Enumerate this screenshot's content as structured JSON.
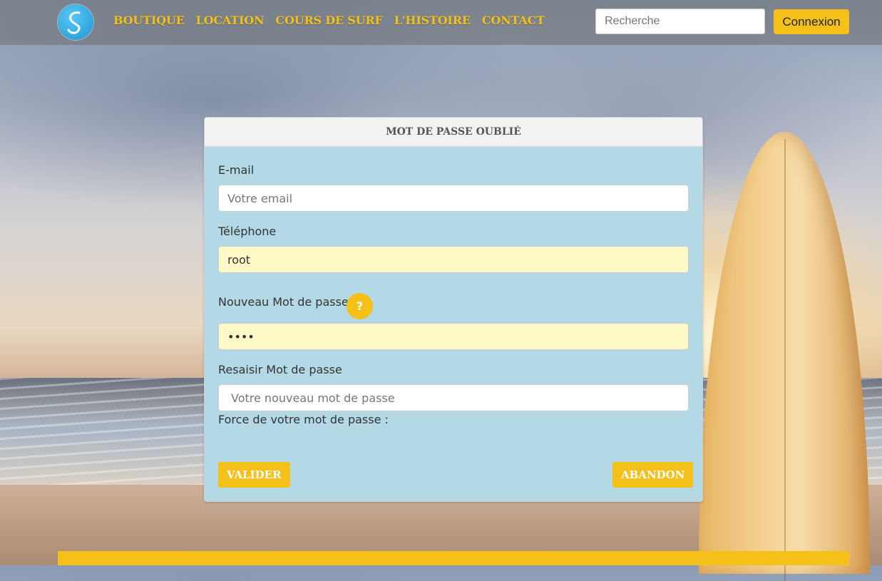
{
  "nav": {
    "links": [
      "BOUTIQUE",
      "LOCATION",
      "COURS DE SURF",
      "L'HISTOIRE",
      "CONTACT"
    ],
    "search_placeholder": "Recherche",
    "login_label": "Connexion"
  },
  "form": {
    "title": "MOT DE PASSE OUBLIÉ",
    "email_label": "E-mail",
    "email_placeholder": "Votre email",
    "phone_label": "Téléphone",
    "phone_value": "root",
    "new_password_label": "Nouveau Mot de passe",
    "help_symbol": "?",
    "new_password_value": "root",
    "repeat_password_label": "Resaisir Mot de passe",
    "repeat_password_placeholder": "Votre nouveau mot de passe",
    "strength_label": "Force de votre mot de passe :",
    "submit_label": "VALIDER",
    "cancel_label": "ABANDON"
  },
  "colors": {
    "accent": "#f5c018",
    "card_bg": "#b3d9e6",
    "autofill_bg": "#fff8c7"
  }
}
